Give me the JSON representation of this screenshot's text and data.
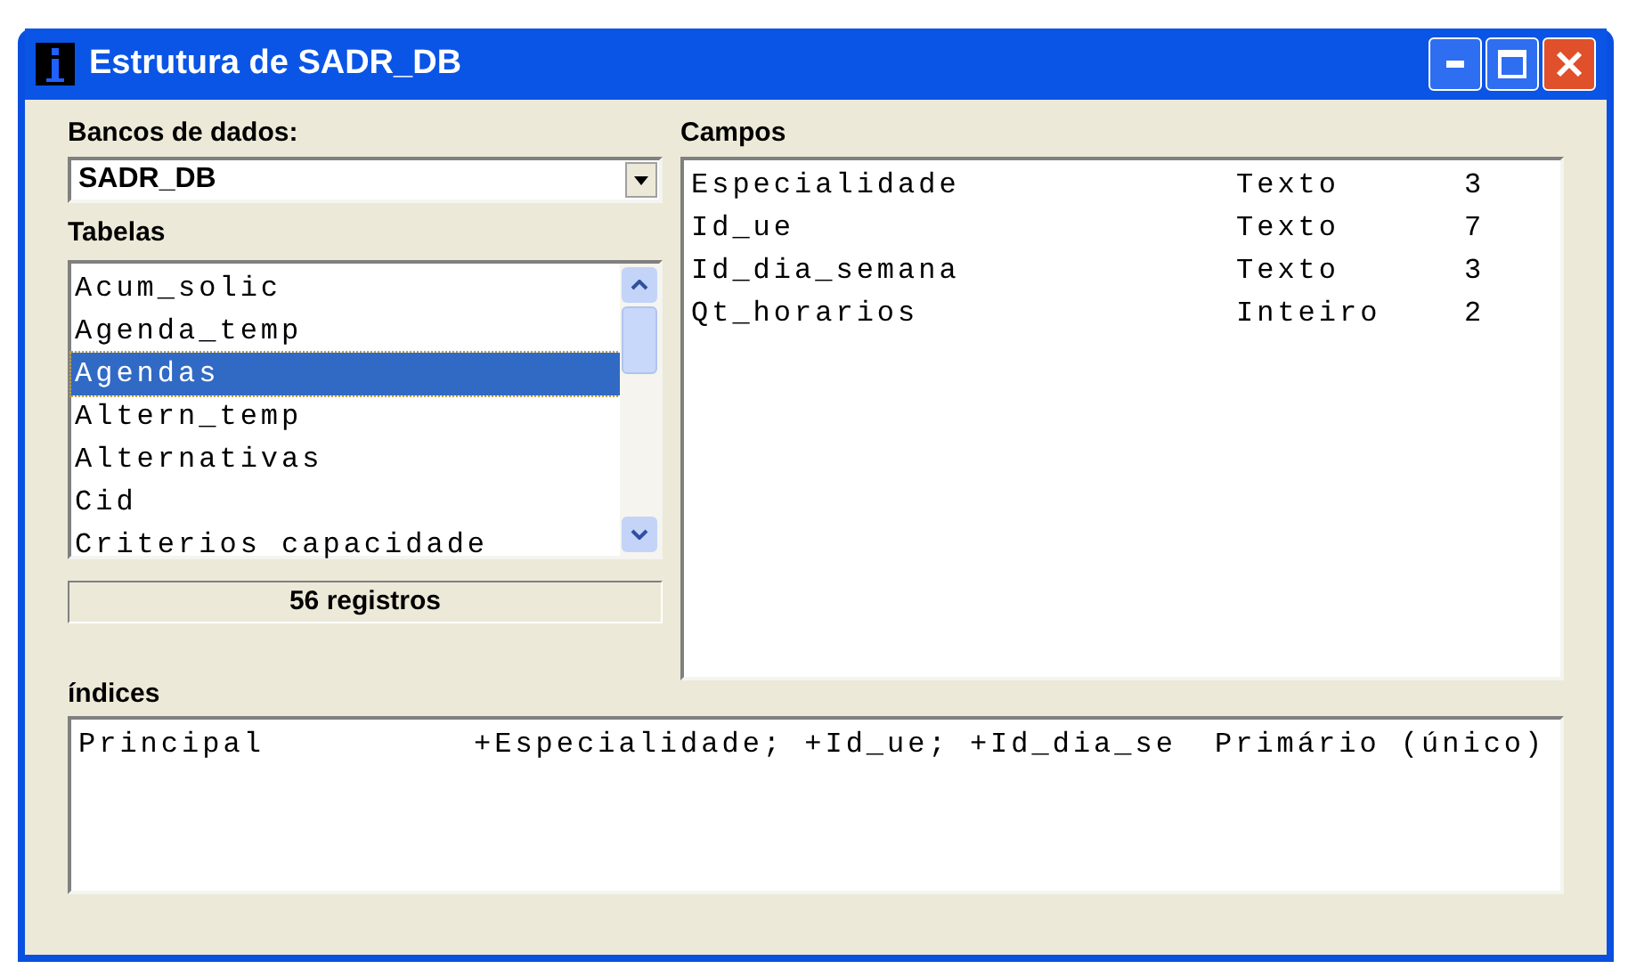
{
  "window": {
    "title": "Estrutura de SADR_DB"
  },
  "databases": {
    "label": "Bancos de dados:",
    "value": "SADR_DB"
  },
  "tables": {
    "label": "Tabelas",
    "items": [
      {
        "name": "Acum_solic",
        "selected": false
      },
      {
        "name": "Agenda_temp",
        "selected": false
      },
      {
        "name": "Agendas",
        "selected": true
      },
      {
        "name": "Altern_temp",
        "selected": false
      },
      {
        "name": "Alternativas",
        "selected": false
      },
      {
        "name": "Cid",
        "selected": false
      },
      {
        "name": "Criterios capacidade",
        "selected": false
      }
    ],
    "count": "56 registros"
  },
  "fields": {
    "label": "Campos",
    "rows": [
      {
        "name": "Especialidade",
        "type": "Texto",
        "size": "3"
      },
      {
        "name": "Id_ue",
        "type": "Texto",
        "size": "7"
      },
      {
        "name": "Id_dia_semana",
        "type": "Texto",
        "size": "3"
      },
      {
        "name": "Qt_horarios",
        "type": "Inteiro",
        "size": "2"
      }
    ]
  },
  "indexes": {
    "label": "índices",
    "rows": [
      {
        "name": "Principal",
        "fields": "+Especialidade; +Id_ue; +Id_dia_se",
        "kind": "Primário (único)"
      }
    ]
  }
}
